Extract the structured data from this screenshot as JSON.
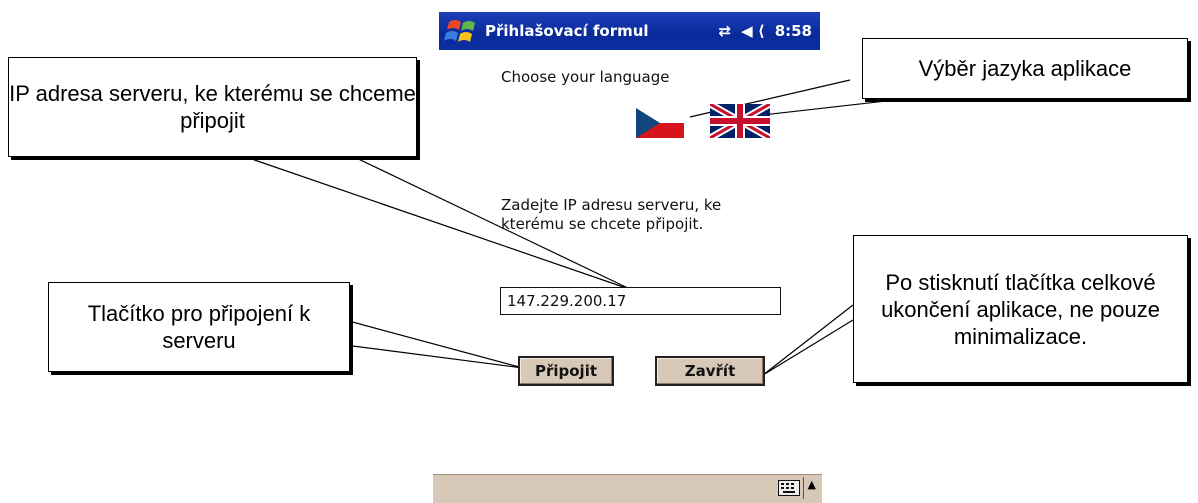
{
  "window": {
    "title": "Přihlašovací formul",
    "connectivity_icon": "sync-arrows-icon",
    "volume_icon": "speaker-icon",
    "time": "8:58"
  },
  "language": {
    "label": "Choose your language",
    "flags": [
      "czech-flag-icon",
      "uk-flag-icon"
    ]
  },
  "server": {
    "prompt": "Zadejte IP adresu serveru, ke kterému se chcete připojit.",
    "ip_value": "147.229.200.17"
  },
  "buttons": {
    "connect": "Připojit",
    "close": "Zavřít"
  },
  "taskbar": {
    "keyboard_icon": "keyboard-icon",
    "sip_arrow_icon": "arrow-up-icon",
    "sip_arrow": "▲"
  },
  "callouts": {
    "ip": "IP adresa serveru, ke kterému se chceme připojit",
    "language": "Výběr jazyka aplikace",
    "connect": "Tlačítko pro připojení k serveru",
    "close": "Po stisknutí tlačítka celkové ukončení aplikace, ne pouze minimalizace."
  }
}
